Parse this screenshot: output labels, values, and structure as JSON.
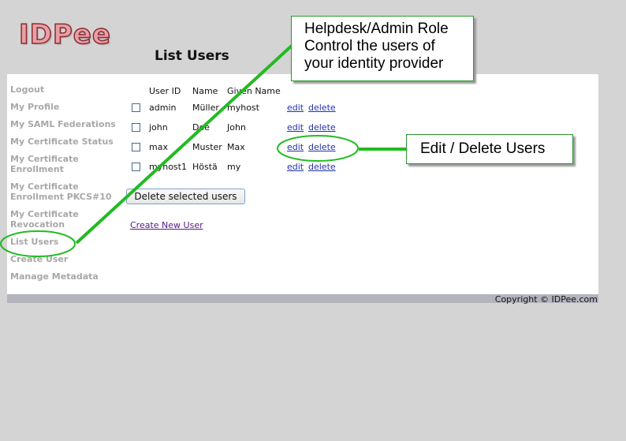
{
  "logo": {
    "text": "IDPee"
  },
  "page_title": "List Users",
  "sidebar": {
    "items": [
      {
        "label": "Logout"
      },
      {
        "label": "My Profile"
      },
      {
        "label": "My SAML Federations"
      },
      {
        "label": "My Certificate Status"
      },
      {
        "label": "My Certificate Enrollment"
      },
      {
        "label": "My Certificate Enrollment PKCS#10"
      },
      {
        "label": "My Certificate Revocation"
      },
      {
        "label": "List Users"
      },
      {
        "label": "Create User"
      },
      {
        "label": "Manage Metadata"
      }
    ]
  },
  "table": {
    "headers": [
      "User ID",
      "Name",
      "Given Name"
    ],
    "rows": [
      {
        "user_id": "admin",
        "name": "Müller",
        "given_name": "myhost",
        "edit": "edit",
        "delete": "delete"
      },
      {
        "user_id": "john",
        "name": "Doe",
        "given_name": "John",
        "edit": "edit",
        "delete": "delete"
      },
      {
        "user_id": "max",
        "name": "Muster",
        "given_name": "Max",
        "edit": "edit",
        "delete": "delete"
      },
      {
        "user_id": "myhost1",
        "name": "Höstä",
        "given_name": "my",
        "edit": "edit",
        "delete": "delete"
      }
    ]
  },
  "delete_selected_label": "Delete selected users",
  "create_new_user_label": "Create New User",
  "copyright": "Copyright © IDPee.com",
  "callouts": {
    "top": [
      "Helpdesk/Admin Role",
      "Control the users of",
      "your identity provider"
    ],
    "right": "Edit / Delete Users"
  },
  "colors": {
    "annotation_green": "#22bb22",
    "link_blue": "#2233aa",
    "sidebar_gray": "#a8a8a8"
  }
}
